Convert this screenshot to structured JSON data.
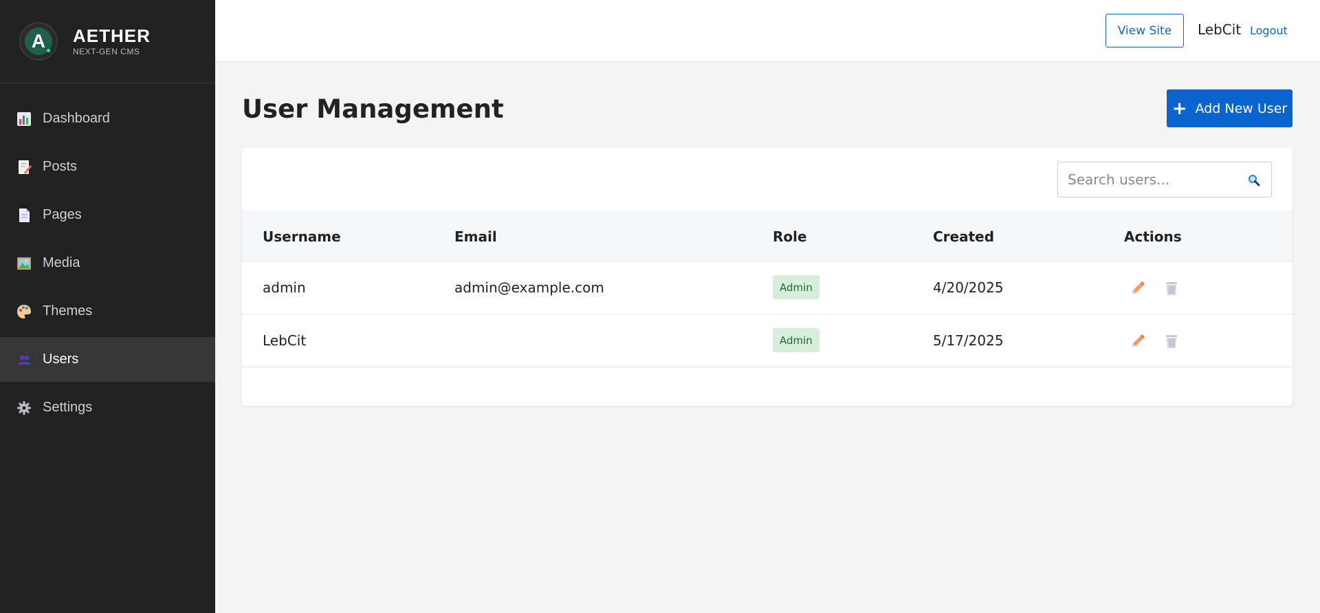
{
  "brand": {
    "title": "AETHER",
    "subtitle": "NEXT-GEN CMS",
    "logo_letter": "A"
  },
  "sidebar": {
    "items": [
      {
        "label": "Dashboard",
        "icon": "bar-chart-icon",
        "active": false
      },
      {
        "label": "Posts",
        "icon": "memo-icon",
        "active": false
      },
      {
        "label": "Pages",
        "icon": "page-icon",
        "active": false
      },
      {
        "label": "Media",
        "icon": "picture-icon",
        "active": false
      },
      {
        "label": "Themes",
        "icon": "palette-icon",
        "active": false
      },
      {
        "label": "Users",
        "icon": "users-icon",
        "active": true
      },
      {
        "label": "Settings",
        "icon": "gear-icon",
        "active": false
      }
    ]
  },
  "header": {
    "view_site": "View Site",
    "user": "LebCit",
    "logout": "Logout"
  },
  "main": {
    "title": "User Management",
    "add_button": "Add New User",
    "add_icon": "+",
    "search": {
      "placeholder": "Search users...",
      "icon": "search-icon"
    }
  },
  "table": {
    "columns": [
      "Username",
      "Email",
      "Role",
      "Created",
      "Actions"
    ],
    "rows": [
      {
        "username": "admin",
        "email": "admin@example.com",
        "role": "Admin",
        "created": "4/20/2025"
      },
      {
        "username": "LebCit",
        "email": "",
        "role": "Admin",
        "created": "5/17/2025"
      }
    ]
  },
  "colors": {
    "sidebar_bg": "#212121",
    "accent": "#0a63cf",
    "badge_bg": "#d6eedb",
    "edit_icon": "#f08c5a"
  }
}
